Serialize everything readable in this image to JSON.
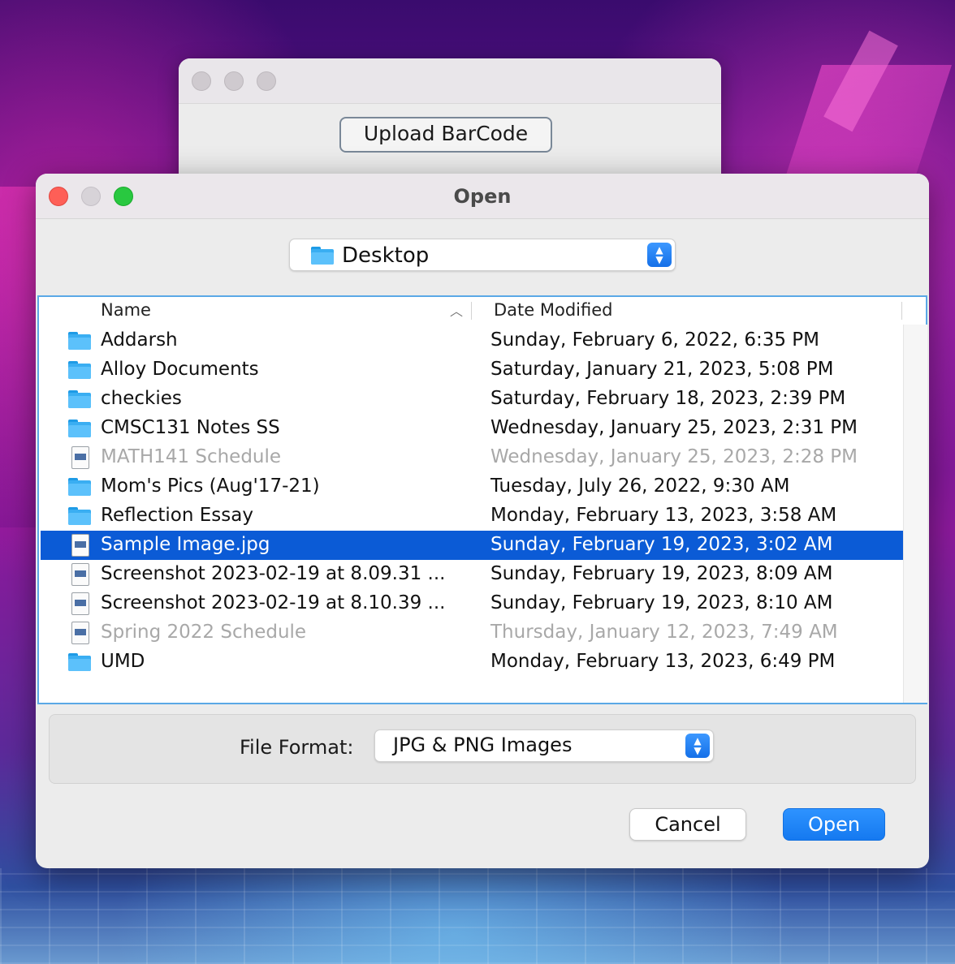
{
  "back_window": {
    "upload_button_label": "Upload BarCode"
  },
  "dialog": {
    "title": "Open",
    "location": {
      "selected": "Desktop",
      "icon": "folder-icon"
    },
    "columns": {
      "name": "Name",
      "date_modified": "Date Modified",
      "sort_indicator": "^"
    },
    "files": [
      {
        "name": "Addarsh",
        "date": "Sunday, February 6, 2022, 6:35 PM",
        "kind": "folder",
        "enabled": true,
        "selected": false
      },
      {
        "name": "Alloy Documents",
        "date": "Saturday, January 21, 2023, 5:08 PM",
        "kind": "folder",
        "enabled": true,
        "selected": false
      },
      {
        "name": "checkies",
        "date": "Saturday, February 18, 2023, 2:39 PM",
        "kind": "folder",
        "enabled": true,
        "selected": false
      },
      {
        "name": "CMSC131 Notes SS",
        "date": "Wednesday, January 25, 2023, 2:31 PM",
        "kind": "folder",
        "enabled": true,
        "selected": false
      },
      {
        "name": "MATH141 Schedule",
        "date": "Wednesday, January 25, 2023, 2:28 PM",
        "kind": "file",
        "enabled": false,
        "selected": false
      },
      {
        "name": "Mom's Pics (Aug'17-21)",
        "date": "Tuesday, July 26, 2022, 9:30 AM",
        "kind": "folder",
        "enabled": true,
        "selected": false
      },
      {
        "name": "Reflection Essay",
        "date": "Monday, February 13, 2023, 3:58 AM",
        "kind": "folder",
        "enabled": true,
        "selected": false
      },
      {
        "name": "Sample Image.jpg",
        "date": "Sunday, February 19, 2023, 3:02 AM",
        "kind": "file",
        "enabled": true,
        "selected": true
      },
      {
        "name": "Screenshot 2023-02-19 at 8.09.31 ...",
        "date": "Sunday, February 19, 2023, 8:09 AM",
        "kind": "file",
        "enabled": true,
        "selected": false
      },
      {
        "name": "Screenshot 2023-02-19 at 8.10.39 ...",
        "date": "Sunday, February 19, 2023, 8:10 AM",
        "kind": "file",
        "enabled": true,
        "selected": false
      },
      {
        "name": "Spring 2022 Schedule",
        "date": "Thursday, January 12, 2023, 7:49 AM",
        "kind": "file",
        "enabled": false,
        "selected": false
      },
      {
        "name": "UMD",
        "date": "Monday, February 13, 2023, 6:49 PM",
        "kind": "folder",
        "enabled": true,
        "selected": false
      }
    ],
    "file_format": {
      "label": "File Format:",
      "selected": "JPG & PNG Images"
    },
    "cancel_label": "Cancel",
    "open_label": "Open"
  },
  "colors": {
    "selection": "#0b5bd6",
    "accent": "#1579f0",
    "folder": "#3aaef2",
    "close": "#fe5f57",
    "zoom": "#29c840"
  }
}
